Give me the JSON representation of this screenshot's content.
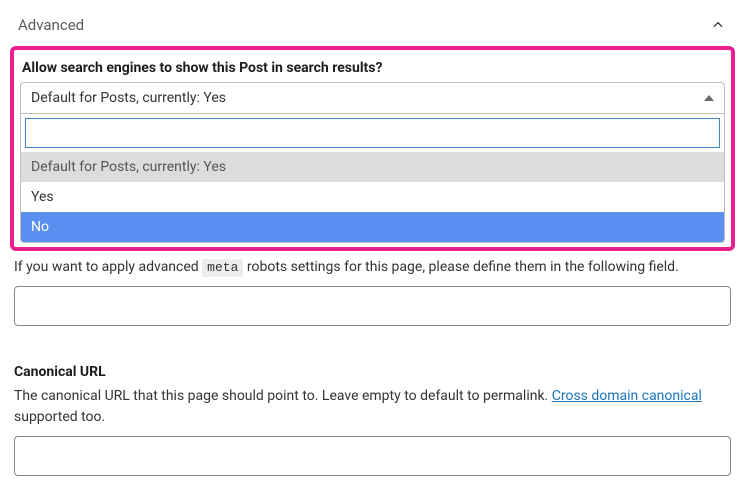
{
  "panel": {
    "title": "Advanced"
  },
  "search_results": {
    "label": "Allow search engines to show this Post in search results?",
    "selected": "Default for Posts, currently: Yes",
    "searchValue": "",
    "options": {
      "default": "Default for Posts, currently: Yes",
      "yes": "Yes",
      "no": "No"
    }
  },
  "meta_robots": {
    "desc_before": "If you want to apply advanced ",
    "code": "meta",
    "desc_after": " robots settings for this page, please define them in the following field.",
    "value": ""
  },
  "canonical": {
    "heading": "Canonical URL",
    "desc_before": "The canonical URL that this page should point to. Leave empty to default to permalink. ",
    "link_text": "Cross domain canonical",
    "desc_after": " supported too.",
    "value": ""
  }
}
